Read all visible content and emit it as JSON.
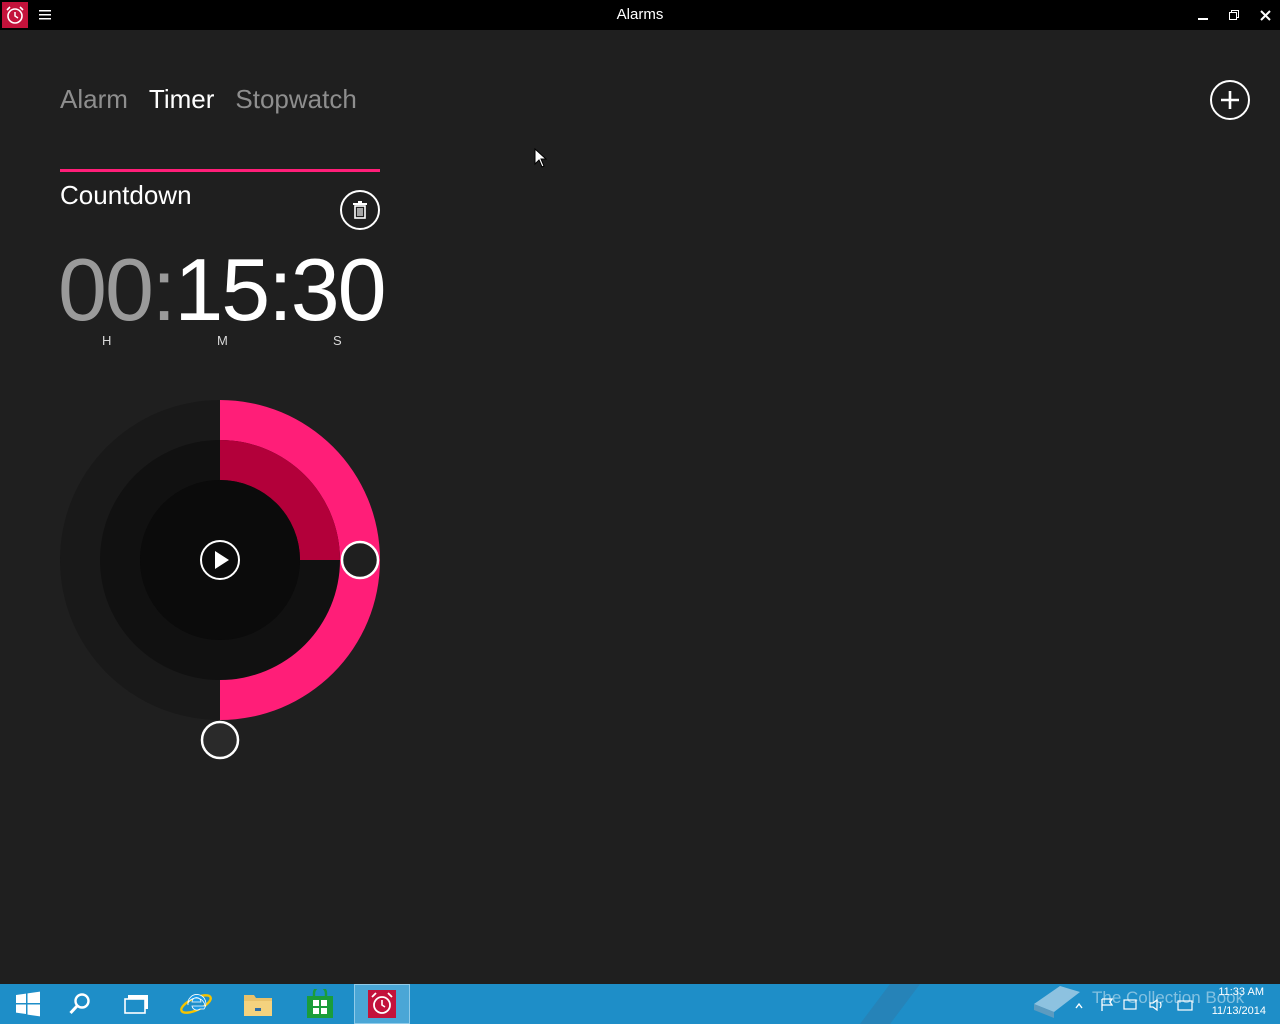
{
  "window": {
    "title": "Alarms"
  },
  "tabs": [
    {
      "label": "Alarm",
      "active": false
    },
    {
      "label": "Timer",
      "active": true
    },
    {
      "label": "Stopwatch",
      "active": false
    }
  ],
  "timer": {
    "name": "Countdown",
    "hours": "00",
    "minutes": "15",
    "seconds": "30",
    "separator": ":",
    "unit_h": "H",
    "unit_m": "M",
    "unit_s": "S",
    "minutes_fraction": 0.25,
    "seconds_fraction": 0.5
  },
  "colors": {
    "accent": "#ff1e78",
    "accent_dark": "#b3003a",
    "background": "#1f1f1f",
    "taskbar": "#1e8ec8"
  },
  "taskbar": {
    "items": [
      {
        "icon": "windows-start-icon"
      },
      {
        "icon": "search-icon"
      },
      {
        "icon": "task-view-icon"
      },
      {
        "icon": "internet-explorer-icon"
      },
      {
        "icon": "file-explorer-icon"
      },
      {
        "icon": "store-icon"
      },
      {
        "icon": "alarm-clock-icon",
        "active": true
      }
    ],
    "watermark": "The Collection Book",
    "clock_time": "11:33 AM",
    "clock_date": "11/13/2014"
  }
}
